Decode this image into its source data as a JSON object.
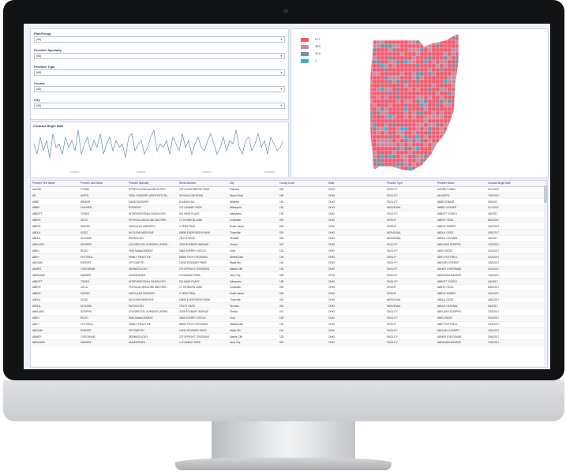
{
  "filters": [
    {
      "label": "Plan/Group",
      "value": "(All)"
    },
    {
      "label": "Provider Specialty",
      "value": "(All)"
    },
    {
      "label": "Provider Type",
      "value": "(All)"
    },
    {
      "label": "County",
      "value": "(All)"
    },
    {
      "label": "City",
      "value": "(All)"
    }
  ],
  "contract_chart": {
    "title": "Contract Begin Date",
    "ticks": [
      "2/2/2017",
      "3/2/2017",
      "6/1/2017",
      "11/2/2017"
    ]
  },
  "chart_data": {
    "type": "line",
    "title": "Contract Begin Date",
    "x": [
      "2/2/2017",
      "3/2/2017",
      "6/1/2017",
      "11/2/2017"
    ],
    "series": [
      {
        "values": [
          7,
          4,
          9,
          5,
          8,
          3,
          10,
          6,
          7,
          4,
          9,
          6,
          8,
          5,
          11,
          4,
          7,
          9,
          5,
          8,
          6,
          10,
          4,
          7,
          9,
          5,
          8,
          6,
          7,
          3,
          9,
          10,
          5,
          7,
          8,
          4,
          6,
          9,
          11,
          5,
          7,
          6,
          8,
          4,
          9,
          7,
          5,
          10,
          6,
          8,
          4,
          7,
          9,
          6,
          5,
          8,
          10,
          7,
          4,
          6,
          9,
          5,
          8,
          7,
          11,
          6,
          4,
          8,
          9,
          5,
          7,
          10,
          6,
          8,
          4,
          9,
          7,
          5,
          6,
          8
        ]
      }
    ],
    "color": "#4a7ab8"
  },
  "map": {
    "legend": [
      {
        "label": "57.1",
        "color": "#f05a6e"
      },
      {
        "label": "38.5",
        "color": "#c7889d"
      },
      {
        "label": "19.8",
        "color": "#7a8f9f"
      },
      {
        "label": "1",
        "color": "#2fb6d6"
      }
    ]
  },
  "table": {
    "columns": [
      "Provider First Name",
      "Provider Last Name",
      "Provider Specialty",
      "Street Address",
      "City",
      "County Code",
      "State",
      "Provider Type",
      "Provider Name",
      "Contract Begin Date"
    ],
    "rows": [
      [
        "AAGRA",
        "TYNAN",
        "GYNECOLOGICAL/ONCOLOGY",
        "1671 SOUTHRIDGE PASS",
        "Fairview",
        "025",
        "OHIO",
        "FACILITY",
        "AAGRA TYNAN",
        "4/17/2017"
      ],
      [
        "AB",
        "AUPOL",
        "ORAL SURGERY (DENTISTS ON...",
        "05 SHALLOW ROAD",
        "Mount Orab",
        "169",
        "OHIO",
        "FACILITY",
        "AB AUPOL",
        "7/26/2017"
      ],
      [
        "ABBE",
        "ERMOR",
        "HAND SURGERY",
        "63 MAIN HILL",
        "Wharton",
        "161",
        "OHIO",
        "FACILITY",
        "ABBE ERMOR",
        "3/3/2017"
      ],
      [
        "ABBIE",
        "OVILNER",
        "PODIATRY",
        "212 CANARY PARK",
        "Willowport",
        "161",
        "OHIO",
        "INDIVIDUAL",
        "ABBIE OVILNER",
        "11/1/2017"
      ],
      [
        "ABBOTT",
        "TODEO",
        "INTERVENTIONAL RADIOLOGY",
        "901 MUIR PLACE",
        "Valleyview",
        "135",
        "OHIO",
        "FACILITY",
        "ABBOTT TODEO",
        "4/4/2017"
      ],
      [
        "ABBYE",
        "CECIL",
        "PHYSICAL MEDICINE AND REH...",
        "17 JOHNSON LANE",
        "Coldwater",
        "009",
        "OHIO",
        "GROUP",
        "ABBYE CECIL",
        "8/20/2017"
      ],
      [
        "ABBYE",
        "SHIRES",
        "VASCULAR SURGERY",
        "2 VERA TRAIL",
        "South Salem",
        "063",
        "OHIO",
        "GROUP",
        "ABBYE SHIRES",
        "4/10/2017"
      ],
      [
        "ABDUL",
        "GOSZ",
        "NUCLEAR MEDICINE",
        "63856 EVERGREEN PARK",
        "Thornville",
        "019",
        "OHIO",
        "INDIVIDUAL",
        "ABDUL GOSZ",
        "4/30/2017"
      ],
      [
        "ABDUL",
        "OLYUNIN",
        "PATHOLOGY",
        "73LIOT PASS",
        "Glouster",
        "003",
        "OHIO",
        "INDIVIDUAL",
        "ABDUL OLYUNIN",
        "2/4/2017"
      ],
      [
        "ABELARD",
        "SCRIPPS",
        "COLORECTAL SURGERY (FORM...",
        "3738 ROXBURY AVENUE",
        "Florida",
        "047",
        "OHIO",
        "FACILITY",
        "ABELARD SCRIPPS",
        "7/23/2017"
      ],
      [
        "ABEU",
        "RIZZO",
        "PAIN MANAGEMENT",
        "1668 SURREY CIRCLE",
        "Cecil",
        "125",
        "OHIO",
        "FACILITY",
        "ABEU RIZZO",
        "2/24/2017"
      ],
      [
        "ABEY",
        "PUTTRELL",
        "FAMILY PRACTICE",
        "84652 TROY CROSSING",
        "Whitehouse",
        "125",
        "OHIO",
        "GROUP",
        "ABEY PUTTRELL",
        "3/13/2017"
      ],
      [
        "ABIGAEL",
        "EVERIST",
        "OPTOMETRY",
        "12092 ROXBURY PASS",
        "Wade Hill",
        "151",
        "OHIO",
        "FACILITY",
        "ABIGAEL EVERIST",
        "1/30/2017"
      ],
      [
        "ABNER",
        "O'SEGRANE",
        "DERMATOLOGY",
        "279 SPRIGHT CROSSING",
        "Marble Cliff",
        "125",
        "OHIO",
        "FACILITY",
        "ABNER O'SEGRANE",
        "2/16/2017"
      ],
      [
        "ABRAHAM",
        "MASSER",
        "UNASSIGNED",
        "14 DONALD PARK",
        "Jerry City",
        "053",
        "OHIO",
        "FACILITY",
        "ABRAHAM MASSER",
        "7/18/2017"
      ],
      [
        "ABBOTT",
        "TODEO",
        "INTERVENTIONAL RADIOLOGY",
        "901 MUIR PLACE",
        "Valleyview",
        "135",
        "OHIO",
        "FACILITY",
        "ABBOTT TODEO",
        "4/4/2017"
      ],
      [
        "ABBYE",
        "CECIL",
        "PHYSICAL MEDICINE AND REH...",
        "17 JOHNSON LANE",
        "Coldwater",
        "009",
        "OHIO",
        "GROUP",
        "ABBYE CECIL",
        "8/20/2017"
      ],
      [
        "ABBYE",
        "SHIRES",
        "VASCULAR SURGERY",
        "2 VERA TRAIL",
        "South Salem",
        "063",
        "OHIO",
        "GROUP",
        "ABBYE SHIRES",
        "4/10/2017"
      ],
      [
        "ABDUL",
        "GOSZ",
        "NUCLEAR MEDICINE",
        "63856 EVERGREEN PARK",
        "Thornville",
        "019",
        "OHIO",
        "INDIVIDUAL",
        "ABDUL GOSZ",
        "4/30/2017"
      ],
      [
        "ABDUL",
        "OLYUNIN",
        "PATHOLOGY",
        "73LIOT PASS",
        "Glouster",
        "003",
        "OHIO",
        "INDIVIDUAL",
        "ABDUL OLYUNIN",
        "2/4/2017"
      ],
      [
        "ABELARD",
        "SCRIPPS",
        "COLORECTAL SURGERY (FORM...",
        "3738 ROXBURY AVENUE",
        "Florida",
        "047",
        "OHIO",
        "FACILITY",
        "ABELARD SCRIPPS",
        "7/23/2017"
      ],
      [
        "ABEU",
        "RIZZO",
        "PAIN MANAGEMENT",
        "1668 SURREY CIRCLE",
        "Cecil",
        "125",
        "OHIO",
        "FACILITY",
        "ABEU RIZZO",
        "2/24/2017"
      ],
      [
        "ABEY",
        "PUTTRELL",
        "FAMILY PRACTICE",
        "84652 TROY CROSSING",
        "Whitehouse",
        "125",
        "OHIO",
        "GROUP",
        "ABEY PUTTRELL",
        "3/13/2017"
      ],
      [
        "ABIGAEL",
        "EVERIST",
        "OPTOMETRY",
        "12092 ROXBURY PASS",
        "Wade Hill",
        "151",
        "OHIO",
        "FACILITY",
        "ABIGAEL EVERIST",
        "1/30/2017"
      ],
      [
        "ABNER",
        "O'SEGRANE",
        "DERMATOLOGY",
        "279 SPRIGHT CROSSING",
        "Marble Cliff",
        "125",
        "OHIO",
        "FACILITY",
        "ABNER O'SEGRANE",
        "2/16/2017"
      ],
      [
        "ABRAHAM",
        "MASSER",
        "UNASSIGNED",
        "14 DONALD PARK",
        "Jerry City",
        "053",
        "OHIO",
        "FACILITY",
        "ABRAHAM MASSER",
        "7/18/2017"
      ]
    ]
  }
}
